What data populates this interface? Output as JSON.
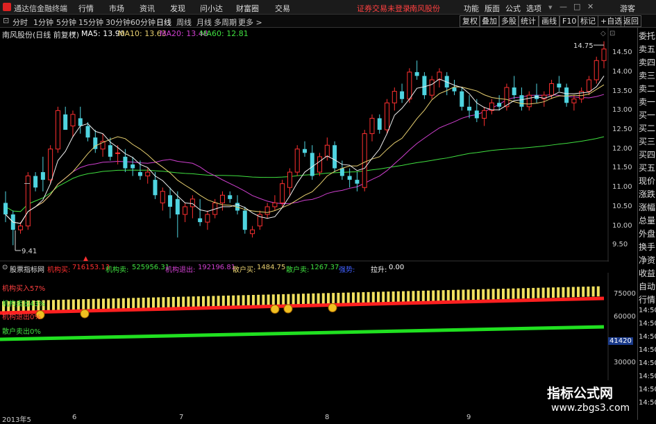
{
  "app": {
    "name": "通达信金融终端"
  },
  "menu": [
    "行情",
    "市场",
    "资讯",
    "发现",
    "问小达",
    "财富圈",
    "交易"
  ],
  "status_red": [
    "证券交易未登录",
    "南风股份"
  ],
  "right_menu": [
    "功能",
    "版面",
    "公式",
    "选项",
    "游客"
  ],
  "periods": [
    "分时",
    "1分钟",
    "5分钟",
    "15分钟",
    "30分钟",
    "60分钟",
    "日线",
    "周线",
    "月线",
    "多周期",
    "更多 >"
  ],
  "active_period": "日线",
  "right_buttons": [
    "复权",
    "叠加",
    "多股",
    "统计",
    "画线",
    "F10",
    "标记",
    "+自选",
    "返回"
  ],
  "chart_header": {
    "stock": "南风股份(日线 前复权)",
    "ma5": "MA5: 13.90",
    "ma10": "MA10: 13.63",
    "ma20": "MA20: 13.48",
    "ma60": "MA60: 12.81"
  },
  "colors": {
    "up": "#ff3030",
    "down": "#4fd4e0",
    "ma5": "#f0f0f0",
    "ma10": "#e8d070",
    "ma20": "#d040d0",
    "ma60": "#40e040"
  },
  "price_annotations": {
    "high": "14.75",
    "low": "9.41"
  },
  "right_panel": [
    "委托",
    "卖五",
    "卖四",
    "卖三",
    "卖二",
    "卖一",
    "买一",
    "买二",
    "买三",
    "买四",
    "买五",
    "现价",
    "涨跌",
    "涨幅",
    "总量",
    "外盘",
    "换手",
    "净资",
    "收益",
    "自动",
    "行情",
    "14:50",
    "14:50",
    "14:50",
    "14:50",
    "14:50",
    "14:50",
    "14:50",
    "14:50"
  ],
  "indicator_header": {
    "name": "股票指标网",
    "jgm_label": "机构买:",
    "jgm_value": "716153.13",
    "jgmc_label": "机构卖:",
    "jgmc_value": "525956.31",
    "jgtc_label": "机构退出:",
    "jgtc_value": "192196.81",
    "shm_label": "散户买:",
    "shm_value": "1484.75",
    "shmc_label": "散户卖:",
    "shmc_value": "1267.37",
    "qs_label": "强势:",
    "ls_label": "拉升:",
    "ls_value": "0.00"
  },
  "indicator_labels": [
    "机构买入57%",
    "机构卖出43%",
    "机构退出0%",
    "散户卖出0%"
  ],
  "indicator_axis": [
    "75000",
    "60000",
    "41420",
    "30000"
  ],
  "dates": [
    "2013年5",
    "6",
    "7",
    "8",
    "9"
  ],
  "watermark": {
    "title": "指标公式网",
    "url": "www.zbgs3.com"
  },
  "chart_data": {
    "type": "candlestick",
    "price_axis": [
      "14.50",
      "14.00",
      "13.50",
      "13.00",
      "12.50",
      "12.00",
      "11.50",
      "11.00",
      "10.50",
      "10.00",
      "9.50"
    ],
    "ylim": [
      9.2,
      14.9
    ],
    "candles": [
      [
        10.6,
        10.9,
        10.1,
        10.3
      ],
      [
        10.3,
        10.4,
        9.5,
        9.9
      ],
      [
        9.9,
        10.1,
        9.8,
        10.0
      ],
      [
        10.0,
        11.4,
        9.9,
        11.3
      ],
      [
        11.3,
        11.4,
        10.9,
        11.0
      ],
      [
        11.4,
        11.8,
        10.9,
        11.2
      ],
      [
        11.2,
        12.1,
        11.1,
        12.0
      ],
      [
        12.0,
        13.1,
        11.9,
        13.0
      ],
      [
        12.9,
        13.1,
        12.5,
        12.5
      ],
      [
        12.6,
        13.0,
        12.3,
        12.9
      ],
      [
        12.8,
        13.1,
        12.4,
        12.6
      ],
      [
        12.6,
        12.7,
        12.2,
        12.3
      ],
      [
        12.3,
        12.5,
        11.9,
        12.0
      ],
      [
        12.0,
        12.4,
        11.8,
        12.2
      ],
      [
        12.1,
        12.3,
        11.7,
        11.8
      ],
      [
        11.9,
        12.1,
        11.6,
        11.9
      ],
      [
        11.8,
        12.0,
        11.4,
        11.5
      ],
      [
        11.6,
        11.8,
        11.3,
        11.5
      ],
      [
        11.4,
        11.7,
        11.2,
        11.3
      ],
      [
        11.3,
        11.5,
        11.1,
        11.4
      ],
      [
        11.2,
        11.4,
        10.7,
        10.8
      ],
      [
        10.6,
        11.0,
        10.4,
        10.9
      ],
      [
        10.8,
        11.0,
        10.2,
        10.5
      ],
      [
        10.7,
        10.9,
        9.7,
        10.3
      ],
      [
        10.3,
        10.6,
        10.1,
        10.5
      ],
      [
        10.5,
        10.8,
        10.2,
        10.7
      ],
      [
        10.2,
        10.7,
        10.0,
        10.1
      ],
      [
        10.1,
        10.4,
        9.9,
        10.3
      ],
      [
        10.3,
        10.7,
        10.2,
        10.6
      ],
      [
        10.6,
        10.9,
        10.4,
        10.8
      ],
      [
        10.8,
        10.9,
        10.6,
        10.7
      ],
      [
        10.6,
        10.8,
        10.3,
        10.4
      ],
      [
        10.4,
        10.5,
        9.8,
        9.9
      ],
      [
        9.8,
        10.0,
        9.7,
        9.9
      ],
      [
        10.0,
        10.4,
        9.9,
        10.3
      ],
      [
        10.3,
        10.6,
        10.2,
        10.5
      ],
      [
        10.5,
        10.8,
        10.4,
        10.6
      ],
      [
        10.6,
        11.2,
        10.5,
        11.1
      ],
      [
        11.0,
        11.5,
        10.8,
        11.4
      ],
      [
        11.4,
        12.1,
        11.3,
        12.0
      ],
      [
        12.0,
        12.2,
        11.8,
        11.9
      ],
      [
        11.9,
        12.1,
        11.2,
        11.3
      ],
      [
        11.4,
        11.9,
        11.3,
        11.8
      ],
      [
        11.8,
        12.3,
        11.7,
        12.1
      ],
      [
        12.1,
        12.2,
        11.4,
        11.5
      ],
      [
        11.5,
        11.7,
        11.2,
        11.3
      ],
      [
        11.3,
        11.5,
        11.0,
        11.2
      ],
      [
        11.2,
        11.4,
        10.9,
        11.1
      ],
      [
        11.0,
        12.5,
        10.9,
        12.4
      ],
      [
        12.4,
        12.9,
        12.2,
        12.8
      ],
      [
        12.8,
        12.9,
        12.4,
        12.5
      ],
      [
        12.5,
        13.3,
        12.4,
        13.2
      ],
      [
        13.2,
        13.6,
        13.0,
        13.5
      ],
      [
        13.5,
        13.7,
        13.2,
        13.3
      ],
      [
        13.3,
        14.1,
        13.2,
        14.0
      ],
      [
        14.0,
        14.3,
        13.8,
        13.9
      ],
      [
        13.9,
        14.0,
        13.3,
        13.4
      ],
      [
        13.4,
        13.9,
        13.3,
        13.8
      ],
      [
        13.8,
        14.1,
        13.6,
        14.0
      ],
      [
        13.9,
        14.0,
        13.4,
        13.6
      ],
      [
        13.6,
        13.8,
        13.4,
        13.5
      ],
      [
        13.5,
        13.6,
        13.0,
        13.1
      ],
      [
        13.1,
        13.4,
        12.8,
        13.0
      ],
      [
        13.0,
        13.3,
        12.7,
        12.8
      ],
      [
        12.8,
        13.1,
        12.6,
        13.0
      ],
      [
        13.0,
        13.3,
        12.9,
        13.2
      ],
      [
        13.2,
        13.4,
        13.0,
        13.1
      ],
      [
        13.1,
        13.7,
        13.0,
        13.6
      ],
      [
        13.6,
        13.9,
        13.3,
        13.4
      ],
      [
        13.4,
        13.6,
        13.0,
        13.1
      ],
      [
        13.1,
        13.5,
        13.0,
        13.4
      ],
      [
        13.4,
        13.7,
        13.2,
        13.3
      ],
      [
        13.3,
        13.5,
        13.1,
        13.4
      ],
      [
        13.4,
        13.8,
        13.3,
        13.7
      ],
      [
        13.7,
        13.9,
        13.5,
        13.6
      ],
      [
        13.6,
        13.7,
        13.1,
        13.2
      ],
      [
        13.2,
        13.4,
        13.0,
        13.3
      ],
      [
        13.3,
        13.6,
        13.2,
        13.5
      ],
      [
        13.5,
        13.9,
        13.4,
        13.8
      ],
      [
        13.8,
        14.4,
        13.7,
        14.3
      ],
      [
        14.3,
        14.8,
        14.1,
        14.6
      ]
    ]
  }
}
